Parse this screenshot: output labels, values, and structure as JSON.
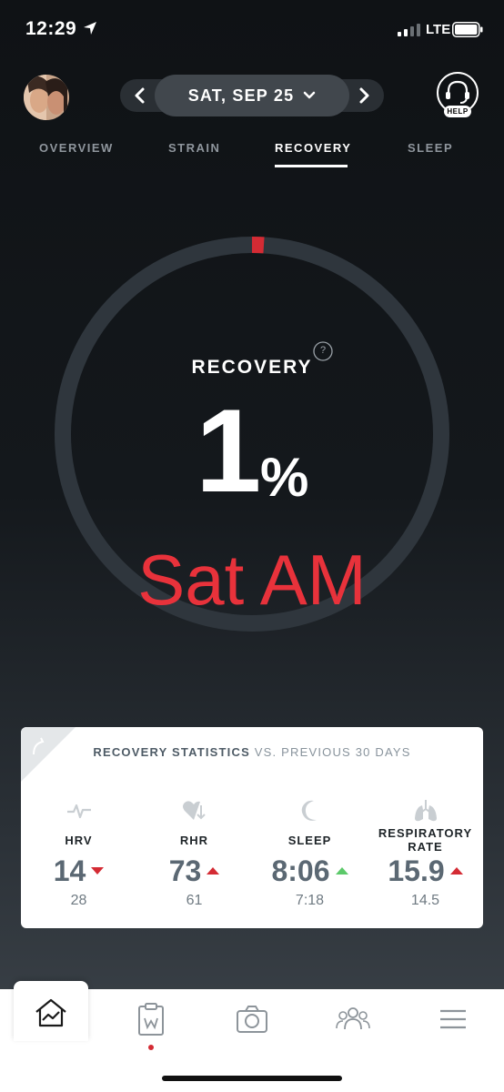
{
  "status_bar": {
    "time": "12:29",
    "network": "LTE"
  },
  "header": {
    "date": "SAT, SEP 25",
    "help_label": "HELP",
    "icons": {
      "prev": "chevron-left-icon",
      "next": "chevron-right-icon",
      "dropdown": "chevron-down-icon",
      "help": "headset-help-icon"
    }
  },
  "tabs": [
    {
      "label": "OVERVIEW",
      "active": false
    },
    {
      "label": "STRAIN",
      "active": false
    },
    {
      "label": "RECOVERY",
      "active": true
    },
    {
      "label": "SLEEP",
      "active": false
    }
  ],
  "recovery": {
    "label": "RECOVERY",
    "help_glyph": "?",
    "value": "1",
    "unit": "%",
    "percent": 1,
    "ring_color": "#d42b34",
    "ring_track_color": "#2f363d",
    "overlay_text": "Sat AM",
    "overlay_color": "#e8323b"
  },
  "stats": {
    "title_bold": "RECOVERY STATISTICS",
    "title_rest": " VS. PREVIOUS 30 DAYS",
    "items": [
      {
        "label": "HRV",
        "value": "14",
        "previous": "28",
        "trend": "down",
        "trend_color": "#d42b34",
        "icon": "heartbeat-icon"
      },
      {
        "label": "RHR",
        "value": "73",
        "previous": "61",
        "trend": "up",
        "trend_color": "#d42b34",
        "icon": "heart-rate-icon"
      },
      {
        "label": "SLEEP",
        "value": "8:06",
        "previous": "7:18",
        "trend": "up",
        "trend_color": "#5cc96a",
        "icon": "moon-icon"
      },
      {
        "label": "RESPIRATORY RATE",
        "value": "15.9",
        "previous": "14.5",
        "trend": "up",
        "trend_color": "#d42b34",
        "icon": "lungs-icon"
      }
    ]
  },
  "bottom_nav": [
    {
      "name": "home",
      "icon": "home-chart-icon",
      "active": true
    },
    {
      "name": "journal",
      "icon": "clipboard-icon",
      "badge": true
    },
    {
      "name": "camera",
      "icon": "camera-icon"
    },
    {
      "name": "community",
      "icon": "team-icon"
    },
    {
      "name": "menu",
      "icon": "hamburger-menu-icon"
    }
  ]
}
